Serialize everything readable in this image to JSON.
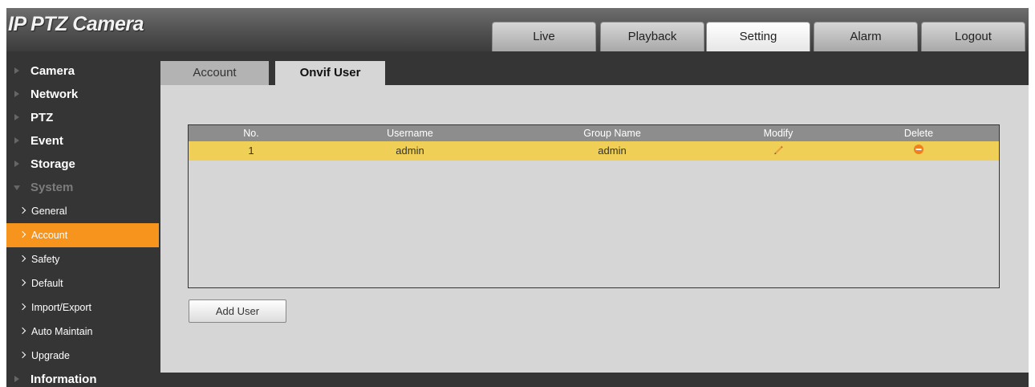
{
  "app": {
    "title": "IP PTZ Camera"
  },
  "nav": [
    {
      "label": "Live",
      "active": false
    },
    {
      "label": "Playback",
      "active": false
    },
    {
      "label": "Setting",
      "active": true
    },
    {
      "label": "Alarm",
      "active": false
    },
    {
      "label": "Logout",
      "active": false
    }
  ],
  "sidebar": {
    "items": [
      {
        "label": "Camera"
      },
      {
        "label": "Network"
      },
      {
        "label": "PTZ"
      },
      {
        "label": "Event"
      },
      {
        "label": "Storage"
      },
      {
        "label": "System",
        "expanded": true
      }
    ],
    "system_children": [
      {
        "label": "General"
      },
      {
        "label": "Account",
        "active": true
      },
      {
        "label": "Safety"
      },
      {
        "label": "Default"
      },
      {
        "label": "Import/Export"
      },
      {
        "label": "Auto Maintain"
      },
      {
        "label": "Upgrade"
      }
    ],
    "after": [
      {
        "label": "Information"
      }
    ]
  },
  "tabs": [
    {
      "label": "Account",
      "active": false
    },
    {
      "label": "Onvif User",
      "active": true
    }
  ],
  "table": {
    "columns": [
      "No.",
      "Username",
      "Group Name",
      "Modify",
      "Delete"
    ],
    "rows": [
      {
        "no": "1",
        "username": "admin",
        "group": "admin",
        "modify_icon": "pencil-icon",
        "delete_icon": "delete-icon"
      }
    ]
  },
  "buttons": {
    "add_user": "Add User"
  },
  "colors": {
    "accent": "#f7941d",
    "row_highlight": "#efcf55",
    "header_bg": "#8d8d8d",
    "delete": "#f07f1e"
  }
}
